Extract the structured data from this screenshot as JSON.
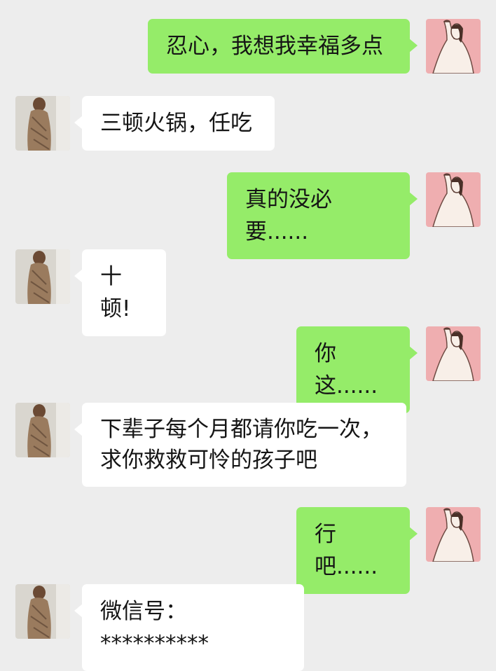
{
  "conversation": {
    "messages": [
      {
        "side": "out",
        "text": "忍心，我想我幸福多点"
      },
      {
        "side": "in",
        "text": "三顿火锅，任吃"
      },
      {
        "side": "out",
        "text": "真的没必要......"
      },
      {
        "side": "in",
        "text": "十顿!"
      },
      {
        "side": "out",
        "text": "你这......"
      },
      {
        "side": "in",
        "text": "下辈子每个月都请你吃一次，\n求你救救可怜的孩子吧"
      },
      {
        "side": "out",
        "text": "行吧......"
      },
      {
        "side": "in",
        "text": "微信号：**********"
      }
    ]
  },
  "colors": {
    "background": "#ededed",
    "outgoing_bubble": "#95ec69",
    "incoming_bubble": "#ffffff",
    "text": "#151515"
  }
}
